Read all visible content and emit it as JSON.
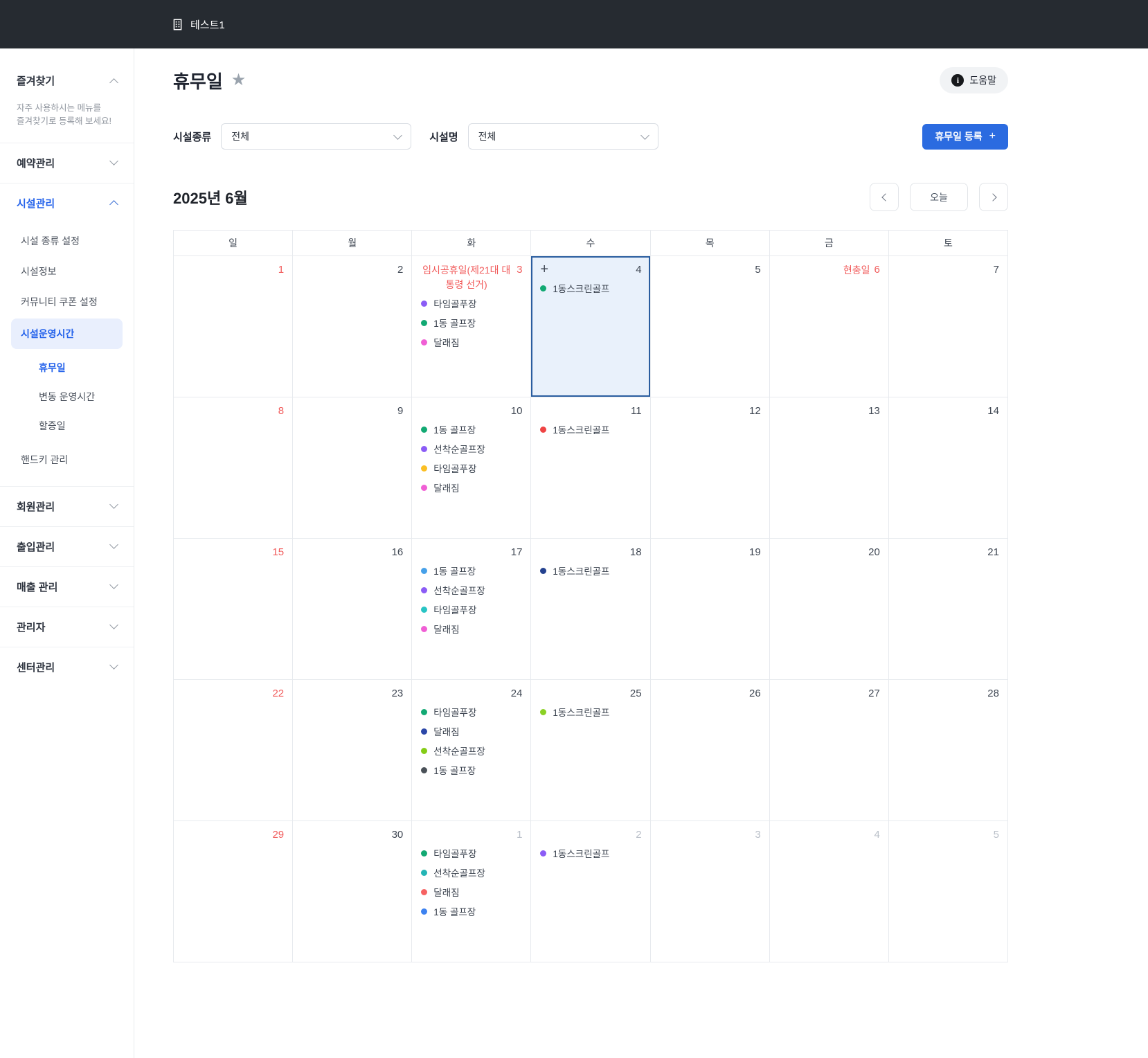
{
  "topbar": {
    "brand": "테스트1"
  },
  "sidebar": {
    "favorites_title": "즐겨찾기",
    "favorites_hint_line1": "자주 사용하시는 메뉴를",
    "favorites_hint_line2": "즐겨찾기로 등록해 보세요!",
    "reservation": "예약관리",
    "facility": "시설관리",
    "facility_children": [
      "시설 종류 설정",
      "시설정보",
      "커뮤니티 쿠폰 설정",
      "시설운영시간"
    ],
    "operating_children": [
      "휴무일",
      "변동 운영시간",
      "할증일"
    ],
    "handkey": "핸드키 관리",
    "member": "회원관리",
    "access": "출입관리",
    "sales": "매출 관리",
    "admin": "관리자",
    "center": "센터관리"
  },
  "header": {
    "title": "휴무일",
    "help_label": "도움말"
  },
  "filters": {
    "type_label": "시설종류",
    "type_value": "전체",
    "name_label": "시설명",
    "name_value": "전체",
    "register_button": "휴무일 등록",
    "register_plus": "+"
  },
  "calendar": {
    "month_title": "2025년 6월",
    "today_label": "오늘",
    "weekdays": [
      "일",
      "월",
      "화",
      "수",
      "목",
      "금",
      "토"
    ],
    "colors": {
      "accent": "#2b6be0",
      "holiday_red": "#f15b5b",
      "selected_border": "#2a5d9f",
      "selected_bg": "#e9f1fb"
    },
    "weeks": [
      [
        {
          "num": "1",
          "red": true
        },
        {
          "num": "2"
        },
        {
          "num": "3",
          "red": true,
          "holiday": "임시공휴일(제21대 대통령 선거)",
          "events": [
            {
              "c": "#8b5cf6",
              "t": "타임골푸장"
            },
            {
              "c": "#12a973",
              "t": "1동 골프장"
            },
            {
              "c": "#f05fd5",
              "t": "달래짐"
            }
          ]
        },
        {
          "num": "4",
          "selected": true,
          "plus": true,
          "events": [
            {
              "c": "#12a973",
              "t": "1동스크린골프"
            }
          ]
        },
        {
          "num": "5"
        },
        {
          "num": "6",
          "red": true,
          "holiday": "현충일"
        },
        {
          "num": "7"
        }
      ],
      [
        {
          "num": "8",
          "red": true
        },
        {
          "num": "9"
        },
        {
          "num": "10",
          "events": [
            {
              "c": "#12a973",
              "t": "1동 골프장"
            },
            {
              "c": "#8b5cf6",
              "t": "선착순골프장"
            },
            {
              "c": "#fbbf24",
              "t": "타임골푸장"
            },
            {
              "c": "#f05fd5",
              "t": "달래짐"
            }
          ]
        },
        {
          "num": "11",
          "events": [
            {
              "c": "#ef4444",
              "t": "1동스크린골프"
            }
          ]
        },
        {
          "num": "12"
        },
        {
          "num": "13"
        },
        {
          "num": "14"
        }
      ],
      [
        {
          "num": "15",
          "red": true
        },
        {
          "num": "16"
        },
        {
          "num": "17",
          "events": [
            {
              "c": "#46a0e9",
              "t": "1동 골프장"
            },
            {
              "c": "#8b5cf6",
              "t": "선착순골프장"
            },
            {
              "c": "#28c4c4",
              "t": "타임골푸장"
            },
            {
              "c": "#f05fd5",
              "t": "달래짐"
            }
          ]
        },
        {
          "num": "18",
          "events": [
            {
              "c": "#24418f",
              "t": "1동스크린골프"
            }
          ]
        },
        {
          "num": "19"
        },
        {
          "num": "20"
        },
        {
          "num": "21"
        }
      ],
      [
        {
          "num": "22",
          "red": true
        },
        {
          "num": "23"
        },
        {
          "num": "24",
          "events": [
            {
              "c": "#12a973",
              "t": "타임골푸장"
            },
            {
              "c": "#2b47a8",
              "t": "달래짐"
            },
            {
              "c": "#84cc16",
              "t": "선착순골프장"
            },
            {
              "c": "#4a5158",
              "t": "1동 골프장"
            }
          ]
        },
        {
          "num": "25",
          "events": [
            {
              "c": "#8bd125",
              "t": "1동스크린골프"
            }
          ]
        },
        {
          "num": "26"
        },
        {
          "num": "27"
        },
        {
          "num": "28"
        }
      ],
      [
        {
          "num": "29",
          "red": true
        },
        {
          "num": "30"
        },
        {
          "num": "1",
          "other": true,
          "events": [
            {
              "c": "#12a973",
              "t": "타임골푸장"
            },
            {
              "c": "#23b5b5",
              "t": "선착순골프장"
            },
            {
              "c": "#f66262",
              "t": "달래짐"
            },
            {
              "c": "#3d82f0",
              "t": "1동 골프장"
            }
          ]
        },
        {
          "num": "2",
          "other": true,
          "events": [
            {
              "c": "#8b5cf6",
              "t": "1동스크린골프"
            }
          ]
        },
        {
          "num": "3",
          "other": true
        },
        {
          "num": "4",
          "other": true
        },
        {
          "num": "5",
          "other": true
        }
      ]
    ]
  }
}
